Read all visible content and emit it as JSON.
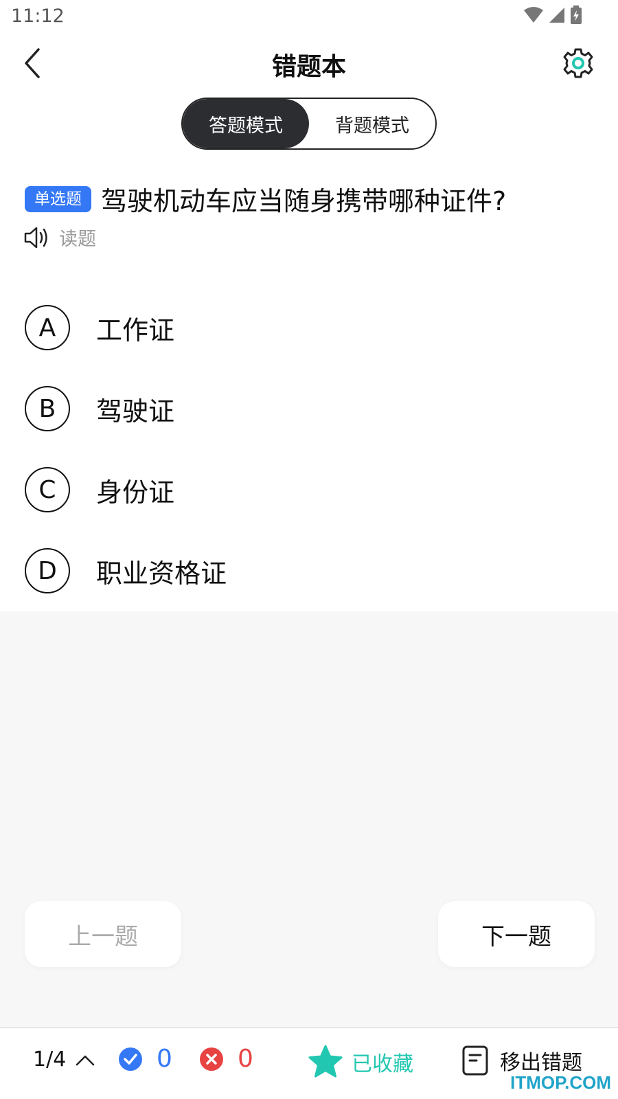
{
  "status_bar": {
    "time": "11:12"
  },
  "header": {
    "title": "错题本"
  },
  "mode_tabs": [
    {
      "label": "答题模式",
      "active": true
    },
    {
      "label": "背题模式",
      "active": false
    }
  ],
  "question": {
    "type_badge": "单选题",
    "text": "驾驶机动车应当随身携带哪种证件?",
    "read_label": "读题"
  },
  "options": [
    {
      "letter": "A",
      "text": "工作证"
    },
    {
      "letter": "B",
      "text": "驾驶证"
    },
    {
      "letter": "C",
      "text": "身份证"
    },
    {
      "letter": "D",
      "text": "职业资格证"
    }
  ],
  "navigation": {
    "prev_label": "上一题",
    "next_label": "下一题"
  },
  "bottom_bar": {
    "progress": "1/4",
    "correct_count": "0",
    "wrong_count": "0",
    "favorite_label": "已收藏",
    "remove_label": "移出错题"
  },
  "watermark": "ITMOP.COM",
  "colors": {
    "accent_blue": "#3478f6",
    "wrong_red": "#e84343",
    "favorite_teal": "#22c7b1",
    "active_tab_bg": "#2c2d31"
  },
  "icons": [
    "wifi-icon",
    "signal-icon",
    "battery-icon",
    "back-arrow-icon",
    "settings-gear-icon",
    "speaker-icon",
    "chevron-up-icon",
    "check-circle-icon",
    "x-circle-icon",
    "star-icon",
    "document-icon"
  ]
}
